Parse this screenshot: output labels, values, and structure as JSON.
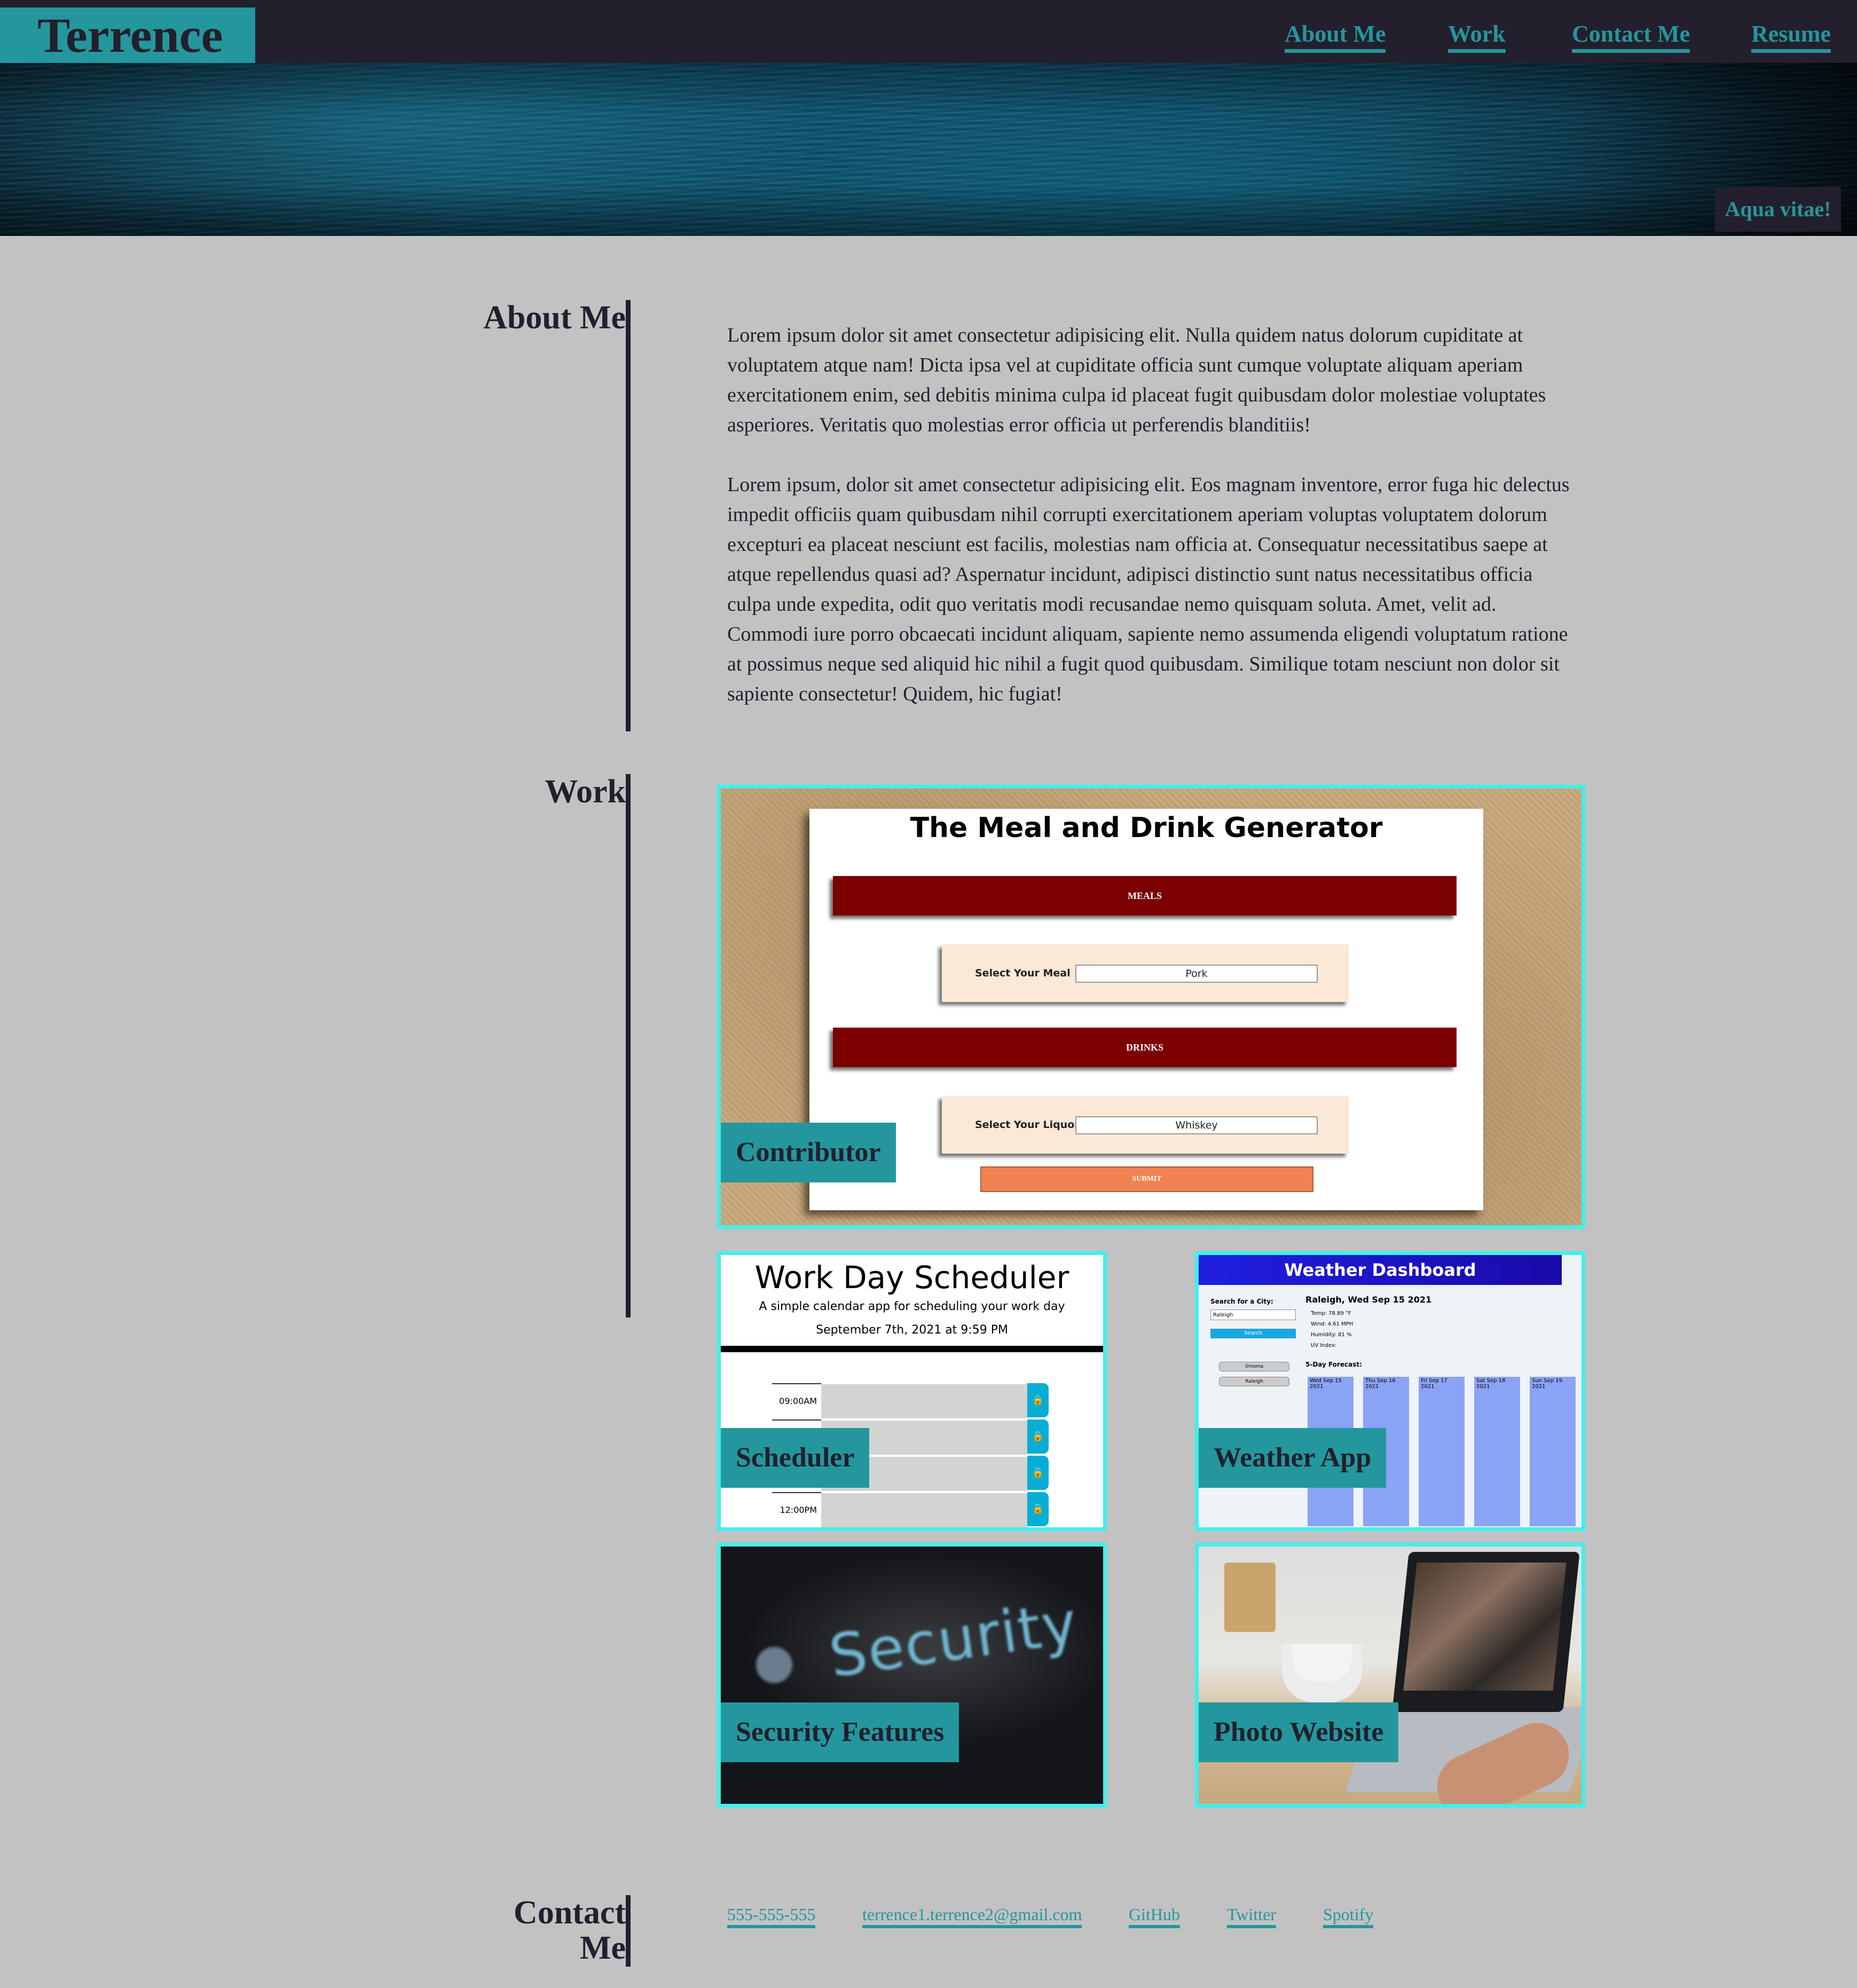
{
  "header": {
    "brand": "Terrence",
    "nav": [
      {
        "label": "About Me"
      },
      {
        "label": "Work"
      },
      {
        "label": "Contact Me"
      },
      {
        "label": "Resume"
      }
    ],
    "tagline": "Aqua vitae!"
  },
  "about": {
    "title": "About Me",
    "paragraphs": [
      "Lorem ipsum dolor sit amet consectetur adipisicing elit. Nulla quidem natus dolorum cupiditate at voluptatem atque nam! Dicta ipsa vel at cupiditate officia sunt cumque voluptate aliquam aperiam exercitationem enim, sed debitis minima culpa id placeat fugit quibusdam dolor molestiae voluptates asperiores. Veritatis quo molestias error officia ut perferendis blanditiis!",
      "Lorem ipsum, dolor sit amet consectetur adipisicing elit. Eos magnam inventore, error fuga hic delectus impedit officiis quam quibusdam nihil corrupti exercitationem aperiam voluptas voluptatem dolorum excepturi ea placeat nesciunt est facilis, molestias nam officia at. Consequatur necessitatibus saepe at atque repellendus quasi ad? Aspernatur incidunt, adipisci distinctio sunt natus necessitatibus officia culpa unde expedita, odit quo veritatis modi recusandae nemo quisquam soluta. Amet, velit ad. Commodi iure porro obcaecati incidunt aliquam, sapiente nemo assumenda eligendi voluptatum ratione at possimus neque sed aliquid hic nihil a fugit quod quibusdam. Similique totam nesciunt non dolor sit sapiente consectetur! Quidem, hic fugiat!"
    ]
  },
  "work": {
    "title": "Work",
    "projects": [
      {
        "label": "Contributor",
        "screenshot": {
          "title": "The Meal and Drink Generator",
          "meals_bar": "MEALS",
          "meal_select_label": "Select Your Meal",
          "meal_select_value": "Pork",
          "drinks_bar": "DRINKS",
          "liquor_select_label": "Select Your Liquor",
          "liquor_select_value": "Whiskey",
          "submit": "SUBMIT"
        }
      },
      {
        "label": "Scheduler",
        "screenshot": {
          "title": "Work Day Scheduler",
          "subtitle": "A simple calendar app for scheduling your work day",
          "date": "September 7th, 2021 at 9:59 PM",
          "hours": [
            "09:00AM",
            "",
            "",
            "12:00PM"
          ]
        }
      },
      {
        "label": "Weather App",
        "screenshot": {
          "title": "Weather Dashboard",
          "search_label": "Search for a City:",
          "search_value": "Raleigh",
          "search_button": "Search",
          "history": [
            "Smoma",
            "Raleigh"
          ],
          "current": "Raleigh, Wed Sep 15 2021",
          "current_details": [
            "Temp: 78.89 °F",
            "Wind: 4.61 MPH",
            "Humidity: 81 %",
            "UV Index:"
          ],
          "forecast_label": "5-Day Forecast:",
          "forecast": [
            "Wed Sep 15 2021",
            "Thu Sep 16 2021",
            "Fri Sep 17 2021",
            "Sat Sep 18 2021",
            "Sun Sep 19 2021"
          ]
        }
      },
      {
        "label": "Security Features",
        "screenshot": {
          "word": "Security"
        }
      },
      {
        "label": "Photo Website"
      }
    ]
  },
  "contact": {
    "title_line1": "Contact",
    "title_line2": "Me",
    "links": [
      {
        "label": "555-555-555"
      },
      {
        "label": "terrence1.terrence2@gmail.com"
      },
      {
        "label": "GitHub"
      },
      {
        "label": "Twitter"
      },
      {
        "label": "Spotify"
      }
    ]
  },
  "colors": {
    "background": "#c2c2c2",
    "dark": "#231f2d",
    "accent": "#23979d",
    "card_border": "#3ff0ec"
  }
}
